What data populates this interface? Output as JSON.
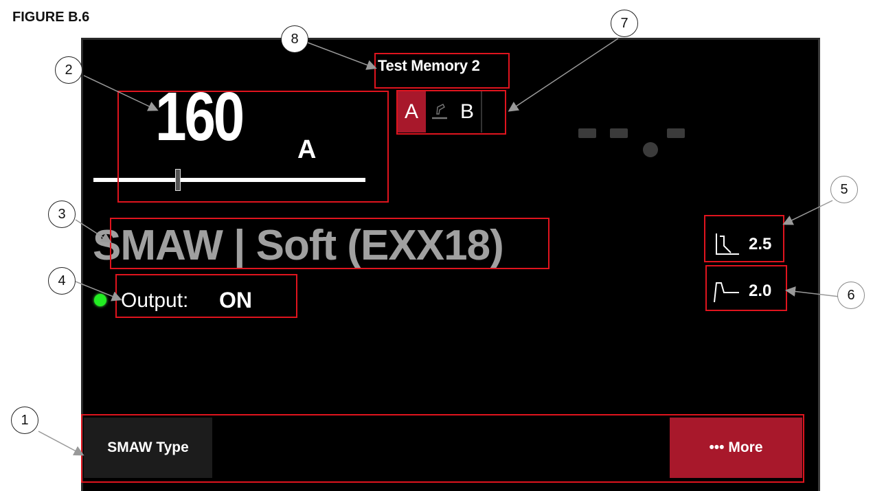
{
  "figure_label": "FIGURE B.6",
  "memory": {
    "name": "Test Memory 2"
  },
  "amperage": {
    "value": "160",
    "unit": "A",
    "level": 0.31
  },
  "ab_selector": {
    "a_label": "A",
    "b_label": "B",
    "active": "A"
  },
  "process": {
    "text": "SMAW | Soft (EXX18)"
  },
  "output": {
    "label": "Output:",
    "value": "ON",
    "led_color": "#22ee22"
  },
  "params": {
    "arc_force": {
      "icon": "arc-force-icon",
      "value": "2.5"
    },
    "hot_start": {
      "icon": "hot-start-icon",
      "value": "2.0"
    }
  },
  "buttons": {
    "smaw_type": "SMAW Type",
    "more": "••• More"
  },
  "callouts": [
    "1",
    "2",
    "3",
    "4",
    "5",
    "6",
    "7",
    "8"
  ],
  "colors": {
    "accent": "#a8182b",
    "highlight_box": "#e0141e",
    "screen_bg": "#000000"
  }
}
